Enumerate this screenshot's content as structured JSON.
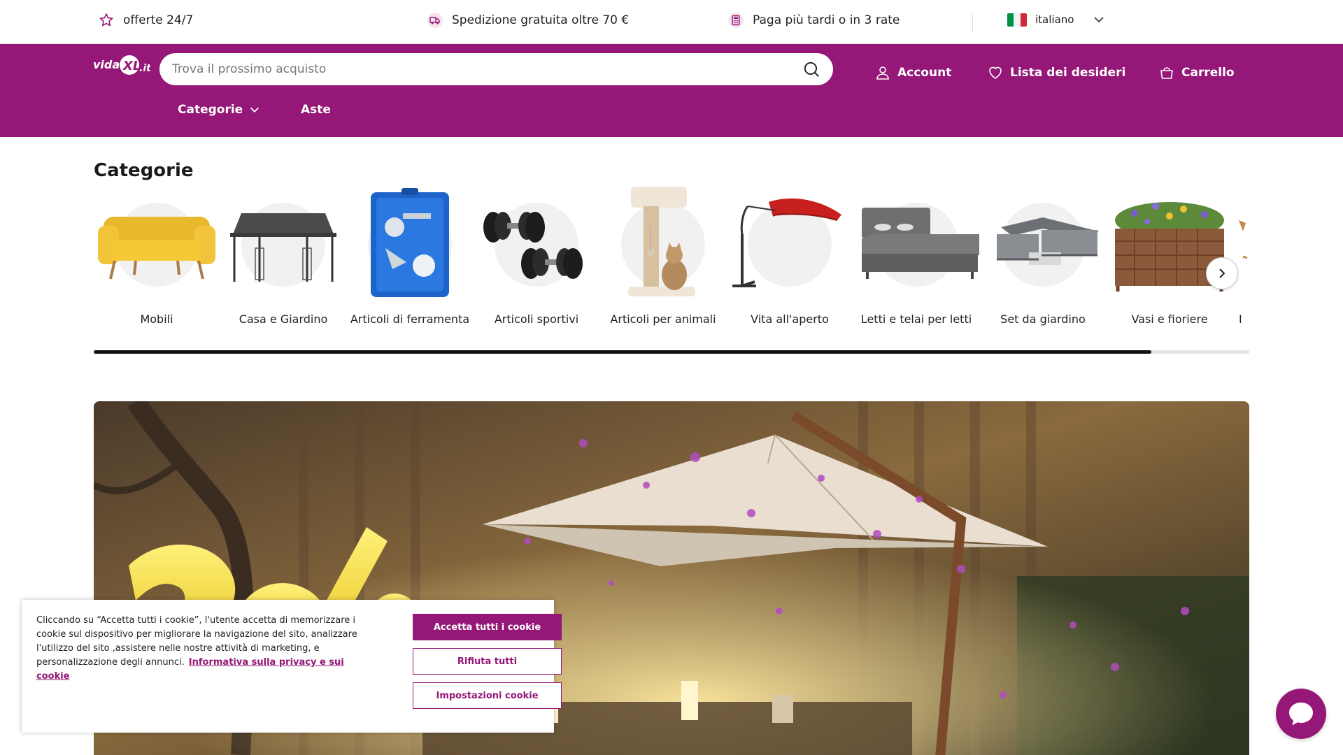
{
  "topbar": {
    "usps": [
      {
        "icon": "star-icon",
        "text": "offerte 24/7"
      },
      {
        "icon": "delivery-truck-icon",
        "text": "Spedizione gratuita oltre 70 €"
      },
      {
        "icon": "calculator-icon",
        "text": "Paga più tardi o in 3 rate"
      }
    ],
    "language": {
      "label": "italiano",
      "flag_colors": [
        "#009246",
        "#ffffff",
        "#ce2b37"
      ]
    }
  },
  "header": {
    "logo_text": "vidaXL.it",
    "search_placeholder": "Trova il prossimo acquisto",
    "links": {
      "account": "Account",
      "wishlist": "Lista dei desideri",
      "cart": "Carrello"
    },
    "nav": {
      "categories": "Categorie",
      "auctions": "Aste"
    }
  },
  "categories": {
    "title": "Categorie",
    "items": [
      {
        "label": "Mobili",
        "icon": "sofa-icon"
      },
      {
        "label": "Casa e Giardino",
        "icon": "gazebo-icon"
      },
      {
        "label": "Articoli di ferramenta",
        "icon": "spray-gun-kit-icon"
      },
      {
        "label": "Articoli sportivi",
        "icon": "dumbbells-icon"
      },
      {
        "label": "Articoli per animali",
        "icon": "cat-tree-icon"
      },
      {
        "label": "Vita all'aperto",
        "icon": "parasol-icon"
      },
      {
        "label": "Letti e telai per letti",
        "icon": "bed-icon"
      },
      {
        "label": "Set da giardino",
        "icon": "garden-set-icon"
      },
      {
        "label": "Vasi e fioriere",
        "icon": "planter-icon"
      },
      {
        "label": "I",
        "icon": "partial-item-icon"
      }
    ],
    "scroll_progress": 0.915
  },
  "banner": {
    "description_icon": "promo-banner-icon"
  },
  "cookie": {
    "text": "Cliccando su “Accetta tutti i cookie”, l'utente accetta di memorizzare i cookie sul dispositivo per migliorare la navigazione del sito, analizzare l'utilizzo del sito ,assistere nelle nostre attività di marketing, e personalizzazione degli annunci.",
    "link": "Informativa sulla privacy e sui cookie",
    "accept": "Accetta tutti i cookie",
    "reject": "Rifiuta tutti",
    "settings": "Impostazioni cookie"
  },
  "colors": {
    "brand": "#951777"
  }
}
